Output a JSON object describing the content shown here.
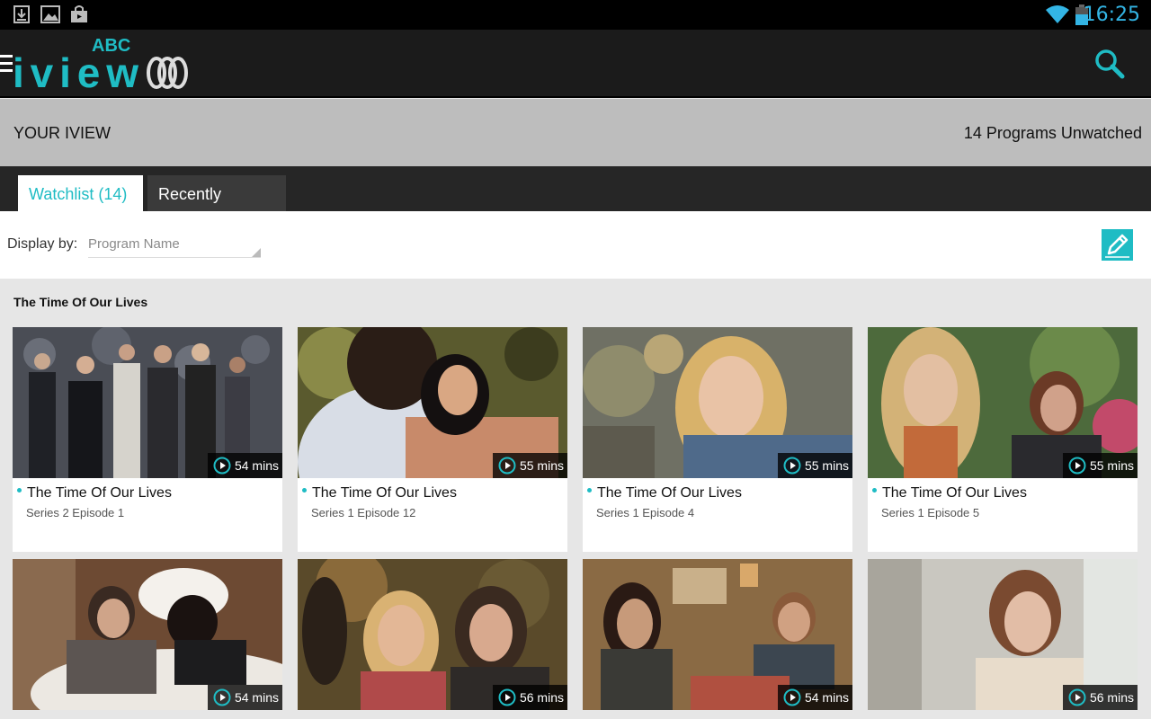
{
  "status_bar": {
    "time": "16:25",
    "icons": [
      "download-icon",
      "image-icon",
      "store-bag-icon",
      "wifi-icon",
      "battery-icon"
    ],
    "time_color": "#33b5e5"
  },
  "action_bar": {
    "logo_top": "ABC",
    "logo_main": "iview",
    "icons": [
      "menu-icon",
      "abc-lissajous-logo-icon",
      "search-icon"
    ],
    "accent_color": "#1fbcc4"
  },
  "header": {
    "title": "YOUR IVIEW",
    "unwatched": "14 Programs Unwatched"
  },
  "tabs": [
    {
      "label": "Watchlist (14)",
      "active": true
    },
    {
      "label": "Recently Viewed",
      "active": false
    }
  ],
  "filter": {
    "label": "Display by:",
    "selected": "Program Name",
    "edit_icon": "pencil-icon"
  },
  "section": {
    "title": "The Time Of Our Lives"
  },
  "cards": [
    {
      "title": "The Time Of Our Lives",
      "episode": "Series 2 Episode 1",
      "duration": "54 mins"
    },
    {
      "title": "The Time Of Our Lives",
      "episode": "Series 1 Episode 12",
      "duration": "55 mins"
    },
    {
      "title": "The Time Of Our Lives",
      "episode": "Series 1 Episode 4",
      "duration": "55 mins"
    },
    {
      "title": "The Time Of Our Lives",
      "episode": "Series 1 Episode 5",
      "duration": "55 mins"
    },
    {
      "title": "",
      "episode": "",
      "duration": "54 mins"
    },
    {
      "title": "",
      "episode": "",
      "duration": "56 mins"
    },
    {
      "title": "",
      "episode": "",
      "duration": "54 mins"
    },
    {
      "title": "",
      "episode": "",
      "duration": "56 mins"
    }
  ]
}
